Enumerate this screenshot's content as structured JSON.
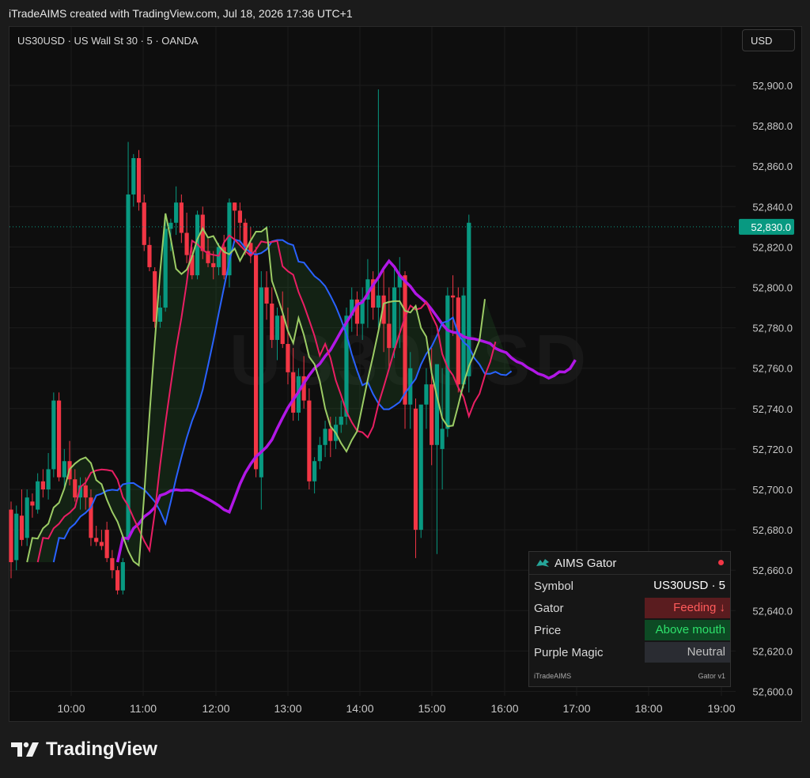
{
  "header": {
    "caption": "iTradeAIMS created with TradingView.com, Jul 18, 2026 17:36 UTC+1"
  },
  "instrument": {
    "label": "US30USD · US Wall St 30 · 5 · OANDA",
    "currency": "USD"
  },
  "watermark": "US30USD",
  "price_axis": {
    "ticks": [
      "52,900.0",
      "52,880.0",
      "52,860.0",
      "52,840.0",
      "52,820.0",
      "52,800.0",
      "52,780.0",
      "52,760.0",
      "52,740.0",
      "52,720.0",
      "52,700.0",
      "52,680.0",
      "52,660.0",
      "52,640.0",
      "52,620.0",
      "52,600.0"
    ],
    "current_price": "52,830.0",
    "current_price_color": "#089981"
  },
  "time_axis": {
    "ticks": [
      "10:00",
      "11:00",
      "12:00",
      "13:00",
      "14:00",
      "15:00",
      "16:00",
      "17:00",
      "18:00",
      "19:00"
    ]
  },
  "colors": {
    "up": "#089981",
    "down": "#f23645",
    "jaw": "#2962ff",
    "teeth": "#e91e63",
    "lips": "#9ccc65",
    "purple": "#b117e6"
  },
  "chart_data": {
    "type": "candlestick",
    "symbol": "US30USD",
    "interval": "5",
    "ylim": [
      52600,
      52910
    ],
    "x_ticks": [
      "10:00",
      "11:00",
      "12:00",
      "13:00",
      "14:00",
      "15:00",
      "16:00",
      "17:00",
      "18:00",
      "19:00"
    ],
    "candles": [
      {
        "o": 52690,
        "h": 52694,
        "l": 52656,
        "c": 52664
      },
      {
        "o": 52665,
        "h": 52692,
        "l": 52660,
        "c": 52688
      },
      {
        "o": 52687,
        "h": 52700,
        "l": 52672,
        "c": 52675
      },
      {
        "o": 52676,
        "h": 52700,
        "l": 52672,
        "c": 52696
      },
      {
        "o": 52694,
        "h": 52698,
        "l": 52686,
        "c": 52692
      },
      {
        "o": 52690,
        "h": 52708,
        "l": 52688,
        "c": 52704
      },
      {
        "o": 52704,
        "h": 52710,
        "l": 52696,
        "c": 52700
      },
      {
        "o": 52700,
        "h": 52718,
        "l": 52695,
        "c": 52710
      },
      {
        "o": 52710,
        "h": 52748,
        "l": 52706,
        "c": 52744
      },
      {
        "o": 52744,
        "h": 52748,
        "l": 52704,
        "c": 52706
      },
      {
        "o": 52706,
        "h": 52720,
        "l": 52700,
        "c": 52714
      },
      {
        "o": 52714,
        "h": 52724,
        "l": 52702,
        "c": 52705
      },
      {
        "o": 52705,
        "h": 52710,
        "l": 52694,
        "c": 52696
      },
      {
        "o": 52696,
        "h": 52706,
        "l": 52690,
        "c": 52702
      },
      {
        "o": 52702,
        "h": 52706,
        "l": 52690,
        "c": 52696
      },
      {
        "o": 52696,
        "h": 52700,
        "l": 52672,
        "c": 52676
      },
      {
        "o": 52676,
        "h": 52682,
        "l": 52672,
        "c": 52674
      },
      {
        "o": 52674,
        "h": 52680,
        "l": 52670,
        "c": 52672
      },
      {
        "o": 52680,
        "h": 52684,
        "l": 52664,
        "c": 52666
      },
      {
        "o": 52666,
        "h": 52670,
        "l": 52656,
        "c": 52660
      },
      {
        "o": 52660,
        "h": 52662,
        "l": 52648,
        "c": 52650
      },
      {
        "o": 52650,
        "h": 52666,
        "l": 52648,
        "c": 52664
      },
      {
        "o": 52676,
        "h": 52872,
        "l": 52674,
        "c": 52846
      },
      {
        "o": 52846,
        "h": 52866,
        "l": 52840,
        "c": 52864
      },
      {
        "o": 52864,
        "h": 52868,
        "l": 52838,
        "c": 52842
      },
      {
        "o": 52842,
        "h": 52846,
        "l": 52818,
        "c": 52821
      },
      {
        "o": 52821,
        "h": 52825,
        "l": 52808,
        "c": 52810
      },
      {
        "o": 52808,
        "h": 52810,
        "l": 52780,
        "c": 52783
      },
      {
        "o": 52783,
        "h": 52796,
        "l": 52780,
        "c": 52790
      },
      {
        "o": 52790,
        "h": 52834,
        "l": 52788,
        "c": 52829
      },
      {
        "o": 52829,
        "h": 52834,
        "l": 52818,
        "c": 52832
      },
      {
        "o": 52832,
        "h": 52850,
        "l": 52826,
        "c": 52842
      },
      {
        "o": 52842,
        "h": 52846,
        "l": 52822,
        "c": 52827
      },
      {
        "o": 52827,
        "h": 52837,
        "l": 52812,
        "c": 52816
      },
      {
        "o": 52816,
        "h": 52820,
        "l": 52804,
        "c": 52806
      },
      {
        "o": 52806,
        "h": 52838,
        "l": 52804,
        "c": 52836
      },
      {
        "o": 52836,
        "h": 52840,
        "l": 52814,
        "c": 52818
      },
      {
        "o": 52818,
        "h": 52824,
        "l": 52810,
        "c": 52812
      },
      {
        "o": 52812,
        "h": 52818,
        "l": 52804,
        "c": 52810
      },
      {
        "o": 52810,
        "h": 52822,
        "l": 52806,
        "c": 52820
      },
      {
        "o": 52820,
        "h": 52826,
        "l": 52804,
        "c": 52806
      },
      {
        "o": 52806,
        "h": 52844,
        "l": 52800,
        "c": 52842
      },
      {
        "o": 52842,
        "h": 52842,
        "l": 52822,
        "c": 52838
      },
      {
        "o": 52838,
        "h": 52842,
        "l": 52822,
        "c": 52832
      },
      {
        "o": 52832,
        "h": 52834,
        "l": 52816,
        "c": 52820
      },
      {
        "o": 52822,
        "h": 52830,
        "l": 52812,
        "c": 52816
      },
      {
        "o": 52816,
        "h": 52820,
        "l": 52706,
        "c": 52710
      },
      {
        "o": 52706,
        "h": 52808,
        "l": 52690,
        "c": 52800
      },
      {
        "o": 52800,
        "h": 52808,
        "l": 52784,
        "c": 52792
      },
      {
        "o": 52792,
        "h": 52800,
        "l": 52770,
        "c": 52774
      },
      {
        "o": 52774,
        "h": 52790,
        "l": 52764,
        "c": 52786
      },
      {
        "o": 52786,
        "h": 52798,
        "l": 52770,
        "c": 52772
      },
      {
        "o": 52772,
        "h": 52790,
        "l": 52752,
        "c": 52758
      },
      {
        "o": 52758,
        "h": 52770,
        "l": 52734,
        "c": 52738
      },
      {
        "o": 52738,
        "h": 52760,
        "l": 52734,
        "c": 52756
      },
      {
        "o": 52756,
        "h": 52766,
        "l": 52740,
        "c": 52744
      },
      {
        "o": 52744,
        "h": 52750,
        "l": 52700,
        "c": 52704
      },
      {
        "o": 52704,
        "h": 52716,
        "l": 52698,
        "c": 52714
      },
      {
        "o": 52714,
        "h": 52726,
        "l": 52710,
        "c": 52722
      },
      {
        "o": 52722,
        "h": 52734,
        "l": 52716,
        "c": 52730
      },
      {
        "o": 52730,
        "h": 52736,
        "l": 52716,
        "c": 52724
      },
      {
        "o": 52724,
        "h": 52736,
        "l": 52720,
        "c": 52732
      },
      {
        "o": 52732,
        "h": 52744,
        "l": 52728,
        "c": 52736
      },
      {
        "o": 52736,
        "h": 52790,
        "l": 52732,
        "c": 52786
      },
      {
        "o": 52786,
        "h": 52800,
        "l": 52778,
        "c": 52794
      },
      {
        "o": 52794,
        "h": 52798,
        "l": 52776,
        "c": 52782
      },
      {
        "o": 52782,
        "h": 52800,
        "l": 52774,
        "c": 52794
      },
      {
        "o": 52794,
        "h": 52814,
        "l": 52780,
        "c": 52804
      },
      {
        "o": 52804,
        "h": 52808,
        "l": 52784,
        "c": 52790
      },
      {
        "o": 52790,
        "h": 52898,
        "l": 52780,
        "c": 52796
      },
      {
        "o": 52796,
        "h": 52810,
        "l": 52768,
        "c": 52782
      },
      {
        "o": 52782,
        "h": 52800,
        "l": 52760,
        "c": 52770
      },
      {
        "o": 52770,
        "h": 52810,
        "l": 52765,
        "c": 52800
      },
      {
        "o": 52800,
        "h": 52815,
        "l": 52770,
        "c": 52806
      },
      {
        "o": 52806,
        "h": 52808,
        "l": 52730,
        "c": 52742
      },
      {
        "o": 52742,
        "h": 52768,
        "l": 52730,
        "c": 52760
      },
      {
        "o": 52740,
        "h": 52745,
        "l": 52666,
        "c": 52680
      },
      {
        "o": 52680,
        "h": 52730,
        "l": 52676,
        "c": 52742
      },
      {
        "o": 52742,
        "h": 52760,
        "l": 52730,
        "c": 52752
      },
      {
        "o": 52752,
        "h": 52770,
        "l": 52712,
        "c": 52722
      },
      {
        "o": 52722,
        "h": 52752,
        "l": 52668,
        "c": 52762
      },
      {
        "o": 52720,
        "h": 52760,
        "l": 52700,
        "c": 52730
      },
      {
        "o": 52730,
        "h": 52800,
        "l": 52726,
        "c": 52796
      },
      {
        "o": 52796,
        "h": 52806,
        "l": 52776,
        "c": 52795
      },
      {
        "o": 52795,
        "h": 52800,
        "l": 52748,
        "c": 52752
      },
      {
        "o": 52752,
        "h": 52800,
        "l": 52750,
        "c": 52796
      },
      {
        "o": 52756,
        "h": 52836,
        "l": 52748,
        "c": 52832
      }
    ],
    "indicators": [
      "Jaw (blue)",
      "Teeth (red)",
      "Lips (green)",
      "Purple Magic line"
    ]
  },
  "panel": {
    "title": "AIMS Gator",
    "rows": [
      {
        "label": "Symbol",
        "value": "US30USD · 5"
      },
      {
        "label": "Gator",
        "value": "Feeding ↓"
      },
      {
        "label": "Price",
        "value": "Above mouth"
      },
      {
        "label": "Purple Magic",
        "value": "Neutral"
      }
    ],
    "footer_left": "iTradeAIMS",
    "footer_right": "Gator v1"
  },
  "branding": {
    "name": "TradingView"
  }
}
